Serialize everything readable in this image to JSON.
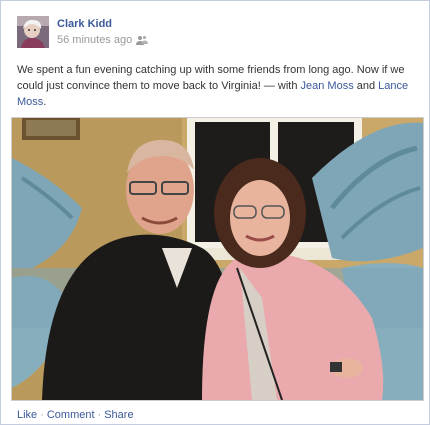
{
  "post": {
    "author": "Clark Kidd",
    "timestamp": "56 minutes ago",
    "audience_icon": "friends-icon",
    "text_main": "We spent a fun evening catching up with some friends from long ago. Now if we could just convince them to move back to Virginia! — with ",
    "tag_1": "Jean Moss",
    "and_word": " and ",
    "tag_2": "Lance Moss",
    "end_punct": "."
  },
  "actions": {
    "like": "Like",
    "comment": "Comment",
    "share": "Share",
    "separator": "·"
  },
  "colors": {
    "link": "#3b5998",
    "border": "#c4cde0",
    "meta": "#999999"
  }
}
